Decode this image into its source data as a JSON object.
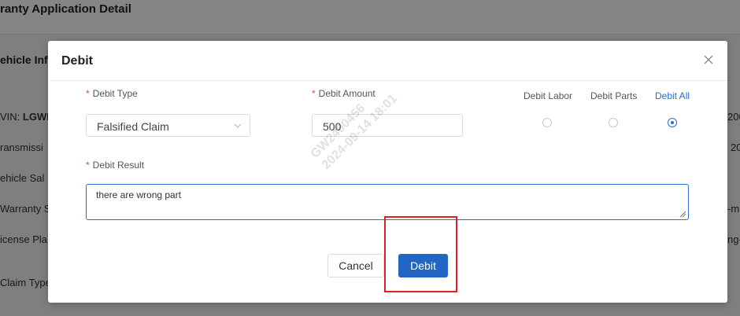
{
  "background": {
    "title": "ranty Application Detail",
    "section": "ehicle Info",
    "rows": [
      {
        "label": "VIN: ",
        "value": "LGWE"
      },
      {
        "label": "ransmissi",
        "value": ""
      },
      {
        "label": "ehicle Sal",
        "value": ""
      },
      {
        "label": "Warranty S",
        "value": ""
      },
      {
        "label": "icense Pla",
        "value": ""
      },
      {
        "label": "Claim Type",
        "value": ""
      }
    ],
    "right_fragments": [
      "200",
      "20",
      "-m",
      "ng-"
    ]
  },
  "modal": {
    "title": "Debit",
    "close_icon": "close-icon",
    "debit_type": {
      "label": "Debit Type",
      "required": "*",
      "value": "Falsified Claim"
    },
    "debit_amount": {
      "label": "Debit Amount",
      "required": "*",
      "value": "500"
    },
    "debit_options": [
      {
        "label": "Debit Labor",
        "selected": false
      },
      {
        "label": "Debit Parts",
        "selected": false
      },
      {
        "label": "Debit All",
        "selected": true
      }
    ],
    "debit_result": {
      "label": "Debit Result",
      "required": "*",
      "value": "there are wrong part"
    },
    "watermark": {
      "line1": "GW2400456",
      "line2": "2024-09-14 18:01"
    },
    "cancel_label": "Cancel",
    "debit_label": "Debit"
  },
  "colors": {
    "accent": "#2266c5",
    "required": "#e04b4b",
    "highlight": "#e02020"
  }
}
